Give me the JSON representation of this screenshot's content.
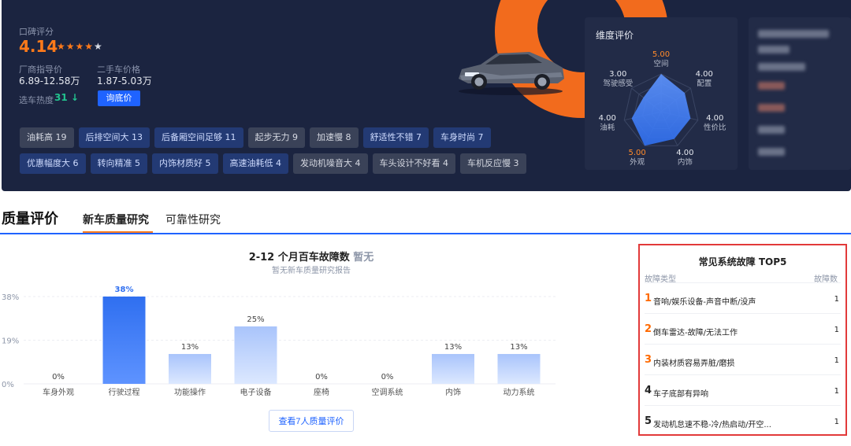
{
  "hero": {
    "rating_label": "口碑评分",
    "rating": "4.14",
    "stars": "★★★★",
    "star_last": "★",
    "msrp_label": "厂商指导价",
    "msrp": "6.89-12.58万",
    "used_label": "二手车价格",
    "used": "1.87-5.03万",
    "heat_label": "选车热度",
    "heat": "31 ↓",
    "price_button": "询底价",
    "tags": [
      {
        "text": "油耗高 19",
        "kind": "neg"
      },
      {
        "text": "后排空间大 13",
        "kind": "pos"
      },
      {
        "text": "后备厢空间足够 11",
        "kind": "pos"
      },
      {
        "text": "起步无力 9",
        "kind": "neg"
      },
      {
        "text": "加速慢 8",
        "kind": "neg"
      },
      {
        "text": "舒适性不错 7",
        "kind": "pos"
      },
      {
        "text": "车身时尚 7",
        "kind": "pos"
      },
      {
        "text": "优惠幅度大 6",
        "kind": "pos"
      },
      {
        "text": "转向精准 5",
        "kind": "pos"
      },
      {
        "text": "内饰材质好 5",
        "kind": "pos"
      },
      {
        "text": "高速油耗低 4",
        "kind": "pos"
      },
      {
        "text": "发动机噪音大 4",
        "kind": "neg"
      },
      {
        "text": "车头设计不好看 4",
        "kind": "neg"
      },
      {
        "text": "车机反应慢 3",
        "kind": "neg"
      }
    ]
  },
  "radar": {
    "title": "维度评价",
    "dims": [
      {
        "name": "空间",
        "score": "5.00",
        "value": 5.0,
        "highlight": true
      },
      {
        "name": "配置",
        "score": "4.00",
        "value": 4.0,
        "highlight": false
      },
      {
        "name": "性价比",
        "score": "4.00",
        "value": 4.0,
        "highlight": false
      },
      {
        "name": "内饰",
        "score": "4.00",
        "value": 4.0,
        "highlight": false
      },
      {
        "name": "外观",
        "score": "5.00",
        "value": 5.0,
        "highlight": true
      },
      {
        "name": "油耗",
        "score": "4.00",
        "value": 4.0,
        "highlight": false
      },
      {
        "name": "驾驶感受",
        "score": "3.00",
        "value": 3.0,
        "highlight": false
      }
    ],
    "max": 5,
    "fill_color": "#2f6ff0"
  },
  "quality": {
    "title": "质量评价",
    "tab_new": "新车质量研究",
    "tab_reliability": "可靠性研究",
    "chart_title": "2-12 个月百车故障数",
    "chart_title_status": "暂无",
    "chart_subtitle": "暂无新车质量研究报告",
    "more_button": "查看7人质量评价"
  },
  "chart_data": {
    "type": "bar",
    "categories": [
      "车身外观",
      "行驶过程",
      "功能操作",
      "电子设备",
      "座椅",
      "空调系统",
      "内饰",
      "动力系统"
    ],
    "values": [
      0,
      38,
      13,
      25,
      0,
      0,
      13,
      13
    ],
    "value_labels": [
      "0%",
      "38%",
      "13%",
      "25%",
      "0%",
      "0%",
      "13%",
      "13%"
    ],
    "yticks": [
      "38%",
      "19%",
      "0%"
    ],
    "ylim": [
      0,
      38
    ],
    "highlight_index": 1,
    "colors": {
      "highlight": "#2f6ff0",
      "normal": "#a9c4fb",
      "highlight_label": "#2f6ff0"
    }
  },
  "top5": {
    "title": "常见系统故障 TOP5",
    "col_type": "故障类型",
    "col_count": "故障数",
    "rows": [
      {
        "rank": "1",
        "name": "音响/娱乐设备-声音中断/没声",
        "count": "1",
        "accent": true
      },
      {
        "rank": "2",
        "name": "倒车雷达-故障/无法工作",
        "count": "1",
        "accent": true
      },
      {
        "rank": "3",
        "name": "内装材质容易弄脏/磨损",
        "count": "1",
        "accent": true
      },
      {
        "rank": "4",
        "name": "车子底部有异响",
        "count": "1",
        "accent": false
      },
      {
        "rank": "5",
        "name": "发动机怠速不稳-冷/热启动/开空...",
        "count": "1",
        "accent": false
      }
    ]
  }
}
